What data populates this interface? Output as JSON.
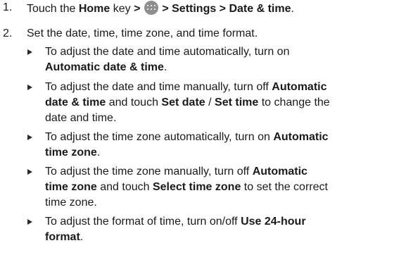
{
  "steps": [
    {
      "number": "1.",
      "parts": [
        {
          "text": "Touch the ",
          "bold": false
        },
        {
          "text": "Home",
          "bold": true
        },
        {
          "text": " key ",
          "bold": false
        },
        {
          "text": ">",
          "bold": true
        },
        {
          "icon": "apps-icon"
        },
        {
          "text": "> Settings > Date & time",
          "bold": true
        },
        {
          "text": ".",
          "bold": false
        }
      ]
    },
    {
      "number": "2.",
      "parts": [
        {
          "text": "Set the date, time, time zone, and time format.",
          "bold": false
        }
      ]
    }
  ],
  "bullets": [
    {
      "parts": [
        {
          "text": "To adjust the date and time automatically, turn on",
          "bold": false
        },
        {
          "br": true
        },
        {
          "text": "Automatic date & time",
          "bold": true
        },
        {
          "text": ".",
          "bold": false
        }
      ]
    },
    {
      "parts": [
        {
          "text": "To adjust the date and time manually, turn off ",
          "bold": false
        },
        {
          "text": "Automatic",
          "bold": true
        },
        {
          "br": true
        },
        {
          "text": "date & time",
          "bold": true
        },
        {
          "text": " and touch ",
          "bold": false
        },
        {
          "text": "Set date",
          "bold": true
        },
        {
          "text": " / ",
          "bold": false
        },
        {
          "text": "Set time",
          "bold": true
        },
        {
          "text": " to change the",
          "bold": false
        },
        {
          "br": true
        },
        {
          "text": "date and time.",
          "bold": false
        }
      ]
    },
    {
      "parts": [
        {
          "text": "To adjust the time zone automatically, turn on ",
          "bold": false
        },
        {
          "text": "Automatic",
          "bold": true
        },
        {
          "br": true
        },
        {
          "text": "time zone",
          "bold": true
        },
        {
          "text": ".",
          "bold": false
        }
      ]
    },
    {
      "parts": [
        {
          "text": "To adjust the time zone manually, turn off ",
          "bold": false
        },
        {
          "text": "Automatic",
          "bold": true
        },
        {
          "br": true
        },
        {
          "text": "time zone",
          "bold": true
        },
        {
          "text": " and touch ",
          "bold": false
        },
        {
          "text": "Select time zone",
          "bold": true
        },
        {
          "text": " to set the correct",
          "bold": false
        },
        {
          "br": true
        },
        {
          "text": "time zone.",
          "bold": false
        }
      ]
    },
    {
      "parts": [
        {
          "text": "To adjust the format of time, turn on/off ",
          "bold": false
        },
        {
          "text": "Use 24-hour",
          "bold": true
        },
        {
          "br": true
        },
        {
          "text": "format",
          "bold": true
        },
        {
          "text": ".",
          "bold": false
        }
      ]
    }
  ]
}
